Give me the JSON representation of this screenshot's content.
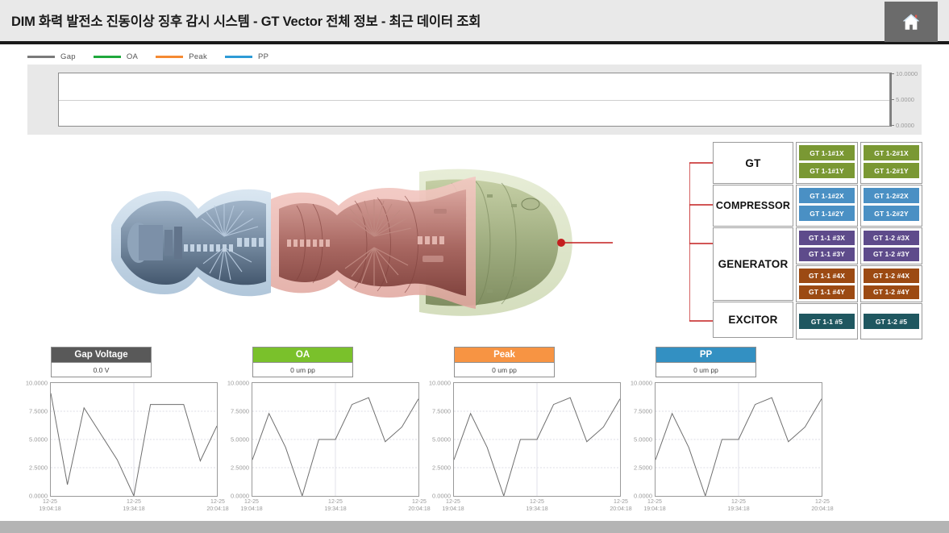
{
  "window": {
    "title": "DIM  화력 발전소 진동이상 징후 감시 시스템 - GT Vector 전체 정보 - 최근 데이터 조회",
    "home_icon": "home-icon"
  },
  "legend": {
    "items": [
      {
        "label": "Gap",
        "color": "#7a7a7a"
      },
      {
        "label": "OA",
        "color": "#1fa83c"
      },
      {
        "label": "Peak",
        "color": "#f58a33"
      },
      {
        "label": "PP",
        "color": "#2e9bd6"
      }
    ]
  },
  "top_chart": {
    "y_ticks": [
      "10.0000",
      "5.0000",
      "0.0000"
    ]
  },
  "sensor_panel": {
    "groups": [
      {
        "name": "GT",
        "label": "GT"
      },
      {
        "name": "COMPRESSOR",
        "label": "COMPRESSOR"
      },
      {
        "name": "GENERATOR",
        "label": "GENERATOR"
      },
      {
        "name": "EXCITOR",
        "label": "EXCITOR"
      }
    ],
    "sensor_rows": [
      {
        "group": "GT",
        "color": "#7a9833",
        "cells": [
          {
            "buttons": [
              "GT 1-1#1X",
              "GT 1-1#1Y"
            ]
          },
          {
            "buttons": [
              "GT 1-2#1X",
              "GT 1-2#1Y"
            ]
          }
        ]
      },
      {
        "group": "COMPRESSOR",
        "color": "#4a90c4",
        "cells": [
          {
            "buttons": [
              "GT 1-1#2X",
              "GT 1-1#2Y"
            ]
          },
          {
            "buttons": [
              "GT 1-2#2X",
              "GT 1-2#2Y"
            ]
          }
        ]
      },
      {
        "group": "GENERATOR",
        "color": "#5e4b8b",
        "cells": [
          {
            "buttons": [
              "GT 1-1 #3X",
              "GT 1-1 #3Y"
            ]
          },
          {
            "buttons": [
              "GT 1-2 #3X",
              "GT 1-2 #3Y"
            ]
          }
        ]
      },
      {
        "group": "GENERATOR",
        "color": "#9c4a13",
        "cells": [
          {
            "buttons": [
              "GT 1-1 #4X",
              "GT 1-1 #4Y"
            ]
          },
          {
            "buttons": [
              "GT 1-2 #4X",
              "GT 1-2 #4Y"
            ]
          }
        ]
      },
      {
        "group": "EXCITOR",
        "color": "#1f5760",
        "cells": [
          {
            "buttons": [
              "GT 1-1 #5"
            ]
          },
          {
            "buttons": [
              "GT 1-2 #5"
            ]
          }
        ]
      }
    ]
  },
  "kpis": [
    {
      "title": "Gap Voltage",
      "value": "0.0 V",
      "color": "#595959"
    },
    {
      "title": "OA",
      "value": "0 um pp",
      "color": "#7ac12b"
    },
    {
      "title": "Peak",
      "value": "0 um pp",
      "color": "#f79443"
    },
    {
      "title": "PP",
      "value": "0 um pp",
      "color": "#3390c2"
    }
  ],
  "chart_data": [
    {
      "type": "line",
      "title": "Gap Voltage",
      "xlabel": "",
      "ylabel": "",
      "ylim": [
        0,
        10
      ],
      "grid": true,
      "legend_position": "none",
      "y_ticks": [
        "10.0000",
        "7.5000",
        "5.0000",
        "2.5000",
        "0.0000"
      ],
      "x_tick_labels": [
        {
          "date": "12-25",
          "time": "19:04:18"
        },
        {
          "date": "12-25",
          "time": "19:34:18"
        },
        {
          "date": "12-25",
          "time": "20:04:18"
        }
      ],
      "series": [
        {
          "name": "Gap",
          "color": "#6e6e6e",
          "x": [
            0,
            1,
            2,
            3,
            4,
            5,
            6,
            7,
            8,
            9,
            10
          ],
          "values": [
            9.1,
            1.0,
            7.8,
            5.5,
            3.2,
            0.0,
            8.1,
            8.1,
            8.1,
            3.1,
            6.2
          ]
        }
      ]
    },
    {
      "type": "line",
      "title": "OA",
      "xlabel": "",
      "ylabel": "",
      "ylim": [
        0,
        10
      ],
      "grid": true,
      "legend_position": "none",
      "y_ticks": [
        "10.0000",
        "7.5000",
        "5.0000",
        "2.5000",
        "0.0000"
      ],
      "x_tick_labels": [
        {
          "date": "12-25",
          "time": "19:04:18"
        },
        {
          "date": "12-25",
          "time": "19:34:18"
        },
        {
          "date": "12-25",
          "time": "20:04:18"
        }
      ],
      "series": [
        {
          "name": "OA",
          "color": "#6e6e6e",
          "x": [
            0,
            1,
            2,
            3,
            4,
            5,
            6,
            7,
            8,
            9,
            10
          ],
          "values": [
            3.2,
            7.3,
            4.3,
            0.0,
            5.0,
            5.0,
            8.1,
            8.7,
            4.8,
            6.1,
            8.6
          ]
        }
      ]
    },
    {
      "type": "line",
      "title": "Peak",
      "xlabel": "",
      "ylabel": "",
      "ylim": [
        0,
        10
      ],
      "grid": true,
      "legend_position": "none",
      "y_ticks": [
        "10.0000",
        "7.5000",
        "5.0000",
        "2.5000",
        "0.0000"
      ],
      "x_tick_labels": [
        {
          "date": "12-25",
          "time": "19:04:18"
        },
        {
          "date": "12-25",
          "time": "19:34:18"
        },
        {
          "date": "12-25",
          "time": "20:04:18"
        }
      ],
      "series": [
        {
          "name": "Peak",
          "color": "#6e6e6e",
          "x": [
            0,
            1,
            2,
            3,
            4,
            5,
            6,
            7,
            8,
            9,
            10
          ],
          "values": [
            3.2,
            7.3,
            4.3,
            0.0,
            5.0,
            5.0,
            8.1,
            8.7,
            4.8,
            6.1,
            8.6
          ]
        }
      ]
    },
    {
      "type": "line",
      "title": "PP",
      "xlabel": "",
      "ylabel": "",
      "ylim": [
        0,
        10
      ],
      "grid": true,
      "legend_position": "none",
      "y_ticks": [
        "10.0000",
        "7.5000",
        "5.0000",
        "2.5000",
        "0.0000"
      ],
      "x_tick_labels": [
        {
          "date": "12-25",
          "time": "19:04:18"
        },
        {
          "date": "12-25",
          "time": "19:34:18"
        },
        {
          "date": "12-25",
          "time": "20:04:18"
        }
      ],
      "series": [
        {
          "name": "PP",
          "color": "#6e6e6e",
          "x": [
            0,
            1,
            2,
            3,
            4,
            5,
            6,
            7,
            8,
            9,
            10
          ],
          "values": [
            3.2,
            7.3,
            4.3,
            0.0,
            5.0,
            5.0,
            8.1,
            8.7,
            4.8,
            6.1,
            8.6
          ]
        }
      ]
    }
  ]
}
